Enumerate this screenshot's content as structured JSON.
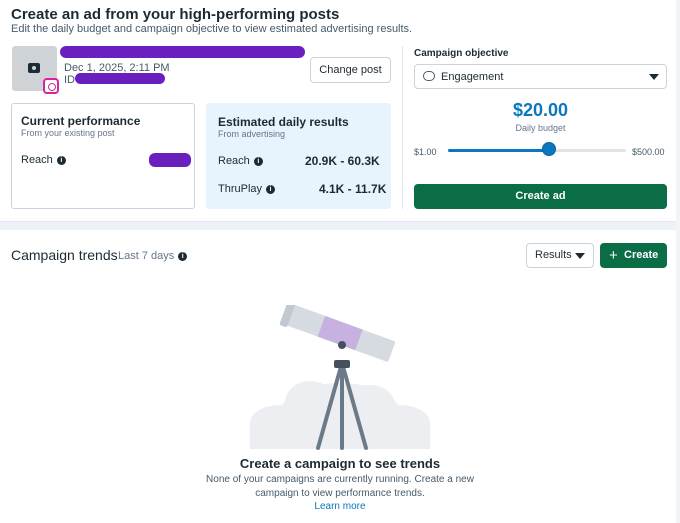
{
  "header": {
    "title": "Create an ad from your high-performing posts",
    "subtitle": "Edit the daily budget and campaign objective to view estimated advertising results."
  },
  "post": {
    "date": "Dec 1, 2025, 2:11 PM",
    "id_label": "ID",
    "change_post_label": "Change post",
    "platform_icon": "instagram-icon"
  },
  "current_performance": {
    "title": "Current performance",
    "subtitle": "From your existing post",
    "reach_label": "Reach"
  },
  "estimated": {
    "title": "Estimated daily results",
    "subtitle": "From advertising",
    "rows": [
      {
        "label": "Reach",
        "value": "20.9K - 60.3K"
      },
      {
        "label": "ThruPlay",
        "value": "4.1K - 11.7K"
      }
    ]
  },
  "objective": {
    "label": "Campaign objective",
    "selected": "Engagement"
  },
  "budget": {
    "amount": "$20.00",
    "label": "Daily budget",
    "min_label": "$1.00",
    "max_label": "$500.00",
    "slider_fraction": 0.57
  },
  "create_ad_label": "Create ad",
  "trends": {
    "title": "Campaign trends",
    "period": "Last 7 days",
    "results_label": "Results",
    "create_label": "Create",
    "empty_title": "Create a campaign to see trends",
    "empty_desc": "None of your campaigns are currently running. Create a new campaign to view performance trends.",
    "learn_more": "Learn more"
  },
  "colors": {
    "accent_blue": "#0a78be",
    "primary_green": "#0a6d46",
    "estimate_bg": "#e7f3fd"
  }
}
